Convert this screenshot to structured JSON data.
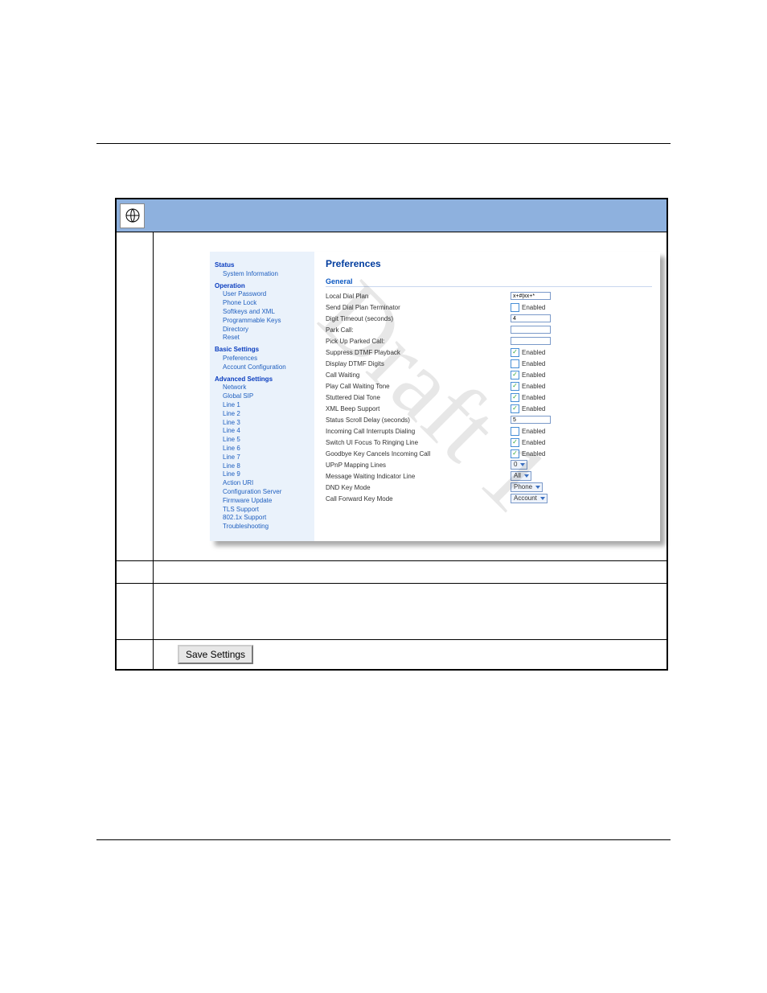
{
  "watermark": "Draft 1",
  "save_button": "Save Settings",
  "sidebar": {
    "groups": [
      {
        "heading": "Status",
        "items": [
          "System Information"
        ]
      },
      {
        "heading": "Operation",
        "items": [
          "User Password",
          "Phone Lock",
          "Softkeys and XML",
          "Programmable Keys",
          "Directory",
          "Reset"
        ]
      },
      {
        "heading": "Basic Settings",
        "items": [
          "Preferences",
          "Account Configuration"
        ]
      },
      {
        "heading": "Advanced Settings",
        "items": [
          "Network",
          "Global SIP",
          "Line 1",
          "Line 2",
          "Line 3",
          "Line 4",
          "Line 5",
          "Line 6",
          "Line 7",
          "Line 8",
          "Line 9",
          "Action URI",
          "Configuration Server",
          "Firmware Update",
          "TLS Support",
          "802.1x Support",
          "Troubleshooting"
        ]
      }
    ]
  },
  "main": {
    "title": "Preferences",
    "section": "General",
    "enabled_label": "Enabled",
    "fields": [
      {
        "label": "Local Dial Plan",
        "type": "text",
        "value": "x+#|xx+*"
      },
      {
        "label": "Send Dial Plan Terminator",
        "type": "check",
        "checked": false
      },
      {
        "label": "Digit Timeout (seconds)",
        "type": "text",
        "value": "4"
      },
      {
        "label": "Park Call:",
        "type": "text",
        "value": ""
      },
      {
        "label": "Pick Up Parked Call:",
        "type": "text",
        "value": ""
      },
      {
        "label": "Suppress DTMF Playback",
        "type": "check",
        "checked": true
      },
      {
        "label": "Display DTMF Digits",
        "type": "check",
        "checked": false
      },
      {
        "label": "Call Waiting",
        "type": "check",
        "checked": true
      },
      {
        "label": "Play Call Waiting Tone",
        "type": "check",
        "checked": true
      },
      {
        "label": "Stuttered Dial Tone",
        "type": "check",
        "checked": true
      },
      {
        "label": "XML Beep Support",
        "type": "check",
        "checked": true
      },
      {
        "label": "Status Scroll Delay (seconds)",
        "type": "text",
        "value": "5"
      },
      {
        "label": "Incoming Call Interrupts Dialing",
        "type": "check",
        "checked": false
      },
      {
        "label": "Switch UI Focus To Ringing Line",
        "type": "check",
        "checked": true
      },
      {
        "label": "Goodbye Key Cancels Incoming Call",
        "type": "check",
        "checked": true
      },
      {
        "label": "UPnP Mapping Lines",
        "type": "select",
        "value": "0"
      },
      {
        "label": "Message Waiting Indicator Line",
        "type": "select",
        "value": "All"
      },
      {
        "label": "DND Key Mode",
        "type": "select",
        "value": "Phone"
      },
      {
        "label": "Call Forward Key Mode",
        "type": "select",
        "value": "Account"
      }
    ]
  }
}
